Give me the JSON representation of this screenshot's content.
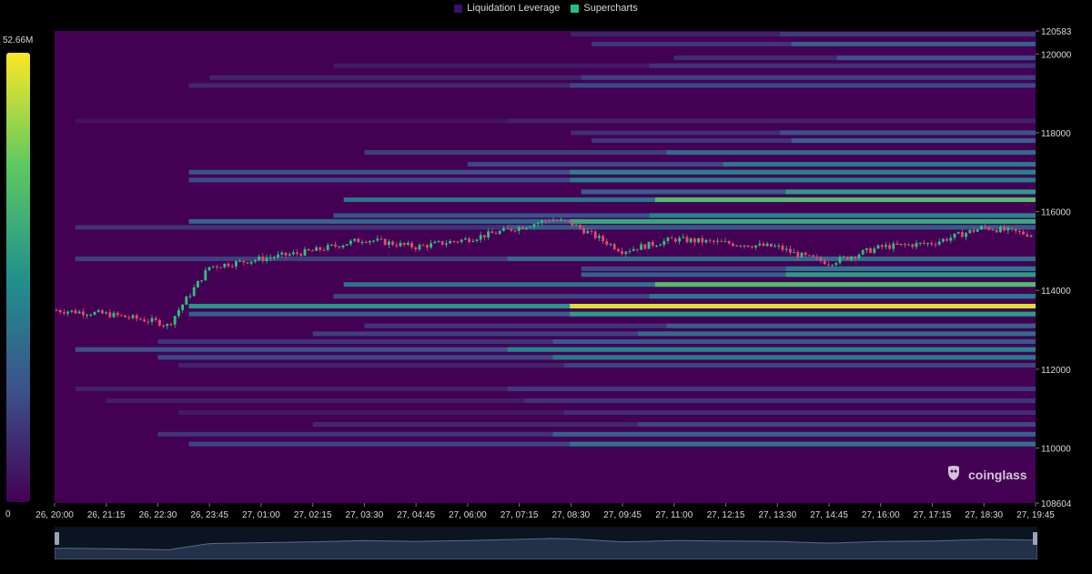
{
  "legend": {
    "items": [
      {
        "label": "Liquidation Leverage",
        "color": "#3a0f66"
      },
      {
        "label": "Supercharts",
        "color": "#21c08a"
      }
    ]
  },
  "colorbar": {
    "max_label": "52.66M",
    "min_label": "0"
  },
  "watermark": "coinglass",
  "chart_data": {
    "type": "heatmap",
    "title": "",
    "xlabel": "",
    "ylabel": "",
    "ylim": [
      108604,
      120583
    ],
    "y_ticks": [
      "120583",
      "120000",
      "118000",
      "116000",
      "114000",
      "112000",
      "110000",
      "108604"
    ],
    "x_ticks": [
      "26, 20:00",
      "26, 21:15",
      "26, 22:30",
      "26, 23:45",
      "27, 01:00",
      "27, 02:15",
      "27, 03:30",
      "27, 04:45",
      "27, 06:00",
      "27, 07:15",
      "27, 08:30",
      "27, 09:45",
      "27, 11:00",
      "27, 12:15",
      "27, 13:30",
      "27, 14:45",
      "27, 16:00",
      "27, 17:15",
      "27, 18:30",
      "27, 19:45"
    ],
    "colorscale": [
      "#440154",
      "#3b528b",
      "#21918c",
      "#5ec962",
      "#fde725"
    ],
    "value_range": [
      0,
      52.66
    ],
    "value_unit": "M",
    "bands": [
      {
        "price": 120500,
        "start": "27, 08:30",
        "intensity": 0.18
      },
      {
        "price": 120250,
        "start": "27, 09:00",
        "intensity": 0.3
      },
      {
        "price": 119900,
        "start": "27, 11:00",
        "intensity": 0.25
      },
      {
        "price": 119700,
        "start": "27, 02:45",
        "intensity": 0.15
      },
      {
        "price": 119400,
        "start": "26, 23:45",
        "intensity": 0.2
      },
      {
        "price": 119200,
        "start": "26, 23:15",
        "intensity": 0.22
      },
      {
        "price": 118300,
        "start": "26, 20:30",
        "intensity": 0.1
      },
      {
        "price": 118000,
        "start": "27, 08:30",
        "intensity": 0.25
      },
      {
        "price": 117800,
        "start": "27, 09:00",
        "intensity": 0.3
      },
      {
        "price": 117500,
        "start": "27, 03:30",
        "intensity": 0.35
      },
      {
        "price": 117200,
        "start": "27, 06:00",
        "intensity": 0.4
      },
      {
        "price": 117000,
        "start": "26, 23:15",
        "intensity": 0.45
      },
      {
        "price": 116800,
        "start": "26, 23:15",
        "intensity": 0.42
      },
      {
        "price": 116500,
        "start": "27, 08:45",
        "intensity": 0.55
      },
      {
        "price": 116300,
        "start": "27, 03:00",
        "intensity": 0.7
      },
      {
        "price": 115900,
        "start": "27, 02:45",
        "intensity": 0.45
      },
      {
        "price": 115750,
        "start": "26, 23:15",
        "intensity": 0.6
      },
      {
        "price": 115600,
        "start": "26, 20:30",
        "intensity": 0.28
      },
      {
        "price": 114800,
        "start": "26, 20:30",
        "intensity": 0.35
      },
      {
        "price": 114550,
        "start": "27, 08:45",
        "intensity": 0.4
      },
      {
        "price": 114400,
        "start": "27, 08:45",
        "intensity": 0.55
      },
      {
        "price": 114150,
        "start": "27, 03:00",
        "intensity": 0.7
      },
      {
        "price": 113850,
        "start": "27, 02:45",
        "intensity": 0.4
      },
      {
        "price": 113600,
        "start": "26, 23:15",
        "intensity": 0.95
      },
      {
        "price": 113400,
        "start": "26, 23:15",
        "intensity": 0.55
      },
      {
        "price": 113100,
        "start": "27, 03:30",
        "intensity": 0.3
      },
      {
        "price": 112900,
        "start": "27, 02:15",
        "intensity": 0.35
      },
      {
        "price": 112700,
        "start": "26, 22:30",
        "intensity": 0.28
      },
      {
        "price": 112500,
        "start": "26, 20:30",
        "intensity": 0.45
      },
      {
        "price": 112300,
        "start": "26, 22:30",
        "intensity": 0.4
      },
      {
        "price": 112100,
        "start": "26, 23:00",
        "intensity": 0.2
      },
      {
        "price": 111500,
        "start": "26, 20:30",
        "intensity": 0.18
      },
      {
        "price": 111200,
        "start": "26, 21:15",
        "intensity": 0.16
      },
      {
        "price": 110900,
        "start": "26, 23:00",
        "intensity": 0.14
      },
      {
        "price": 110600,
        "start": "27, 02:15",
        "intensity": 0.22
      },
      {
        "price": 110350,
        "start": "26, 22:30",
        "intensity": 0.3
      },
      {
        "price": 110100,
        "start": "26, 23:15",
        "intensity": 0.38
      }
    ],
    "price_series": {
      "name": "",
      "x": [
        "26, 20:00",
        "26, 21:15",
        "26, 22:30",
        "26, 22:45",
        "26, 23:00",
        "26, 23:45",
        "27, 01:00",
        "27, 02:15",
        "27, 03:30",
        "27, 04:45",
        "27, 06:00",
        "27, 07:15",
        "27, 08:00",
        "27, 08:30",
        "27, 09:45",
        "27, 11:00",
        "27, 12:15",
        "27, 13:30",
        "27, 14:00",
        "27, 14:45",
        "27, 16:00",
        "27, 17:15",
        "27, 18:30",
        "27, 19:45"
      ],
      "y": [
        113500,
        113400,
        113200,
        113100,
        113500,
        114600,
        114800,
        115000,
        115300,
        115100,
        115300,
        115600,
        115800,
        115700,
        115000,
        115300,
        115200,
        115100,
        114900,
        114700,
        115100,
        115200,
        115600,
        115400
      ]
    }
  }
}
